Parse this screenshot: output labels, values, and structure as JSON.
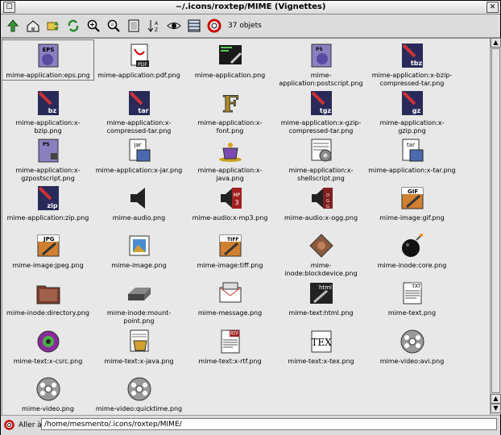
{
  "window": {
    "title": "~/.icons/roxtep/MIME (Vignettes)"
  },
  "toolbar": {
    "count_label": "37 objets"
  },
  "bottom": {
    "label": "Aller à :",
    "path": "/home/mesmento/.icons/roxtep/MIME/"
  },
  "items": [
    {
      "label": "mime-application:eps.png",
      "icon": "eps-icon"
    },
    {
      "label": "mime-application:pdf.png",
      "icon": "pdf-icon"
    },
    {
      "label": "mime-application.png",
      "icon": "application-icon"
    },
    {
      "label": "mime-application:postscript.png",
      "icon": "postscript-icon"
    },
    {
      "label": "mime-application:x-bzip-compressed-tar.png",
      "icon": "tbz-icon"
    },
    {
      "label": "mime-application:x-bzip.png",
      "icon": "bz-icon"
    },
    {
      "label": "mime-application:x-compressed-tar.png",
      "icon": "tar-icon"
    },
    {
      "label": "mime-application:x-font.png",
      "icon": "font-icon"
    },
    {
      "label": "mime-application:x-gzip-compressed-tar.png",
      "icon": "tgz-icon"
    },
    {
      "label": "mime-application:x-gzip.png",
      "icon": "gz-icon"
    },
    {
      "label": "mime-application:x-gzpostscript.png",
      "icon": "gzps-icon"
    },
    {
      "label": "mime-application:x-jar.png",
      "icon": "jar-icon"
    },
    {
      "label": "mime-application:x-java.png",
      "icon": "java-cup-icon"
    },
    {
      "label": "mime-application:x-shellscript.png",
      "icon": "shellscript-icon"
    },
    {
      "label": "mime-application:x-tar.png",
      "icon": "tar-box-icon"
    },
    {
      "label": "mime-application:zip.png",
      "icon": "zip-icon"
    },
    {
      "label": "mime-audio.png",
      "icon": "speaker-icon"
    },
    {
      "label": "mime-audio:x-mp3.png",
      "icon": "mp3-icon"
    },
    {
      "label": "mime-audio:x-ogg.png",
      "icon": "ogg-icon"
    },
    {
      "label": "mime-image:gif.png",
      "icon": "gif-icon"
    },
    {
      "label": "mime-image:jpeg.png",
      "icon": "jpeg-icon"
    },
    {
      "label": "mime-image.png",
      "icon": "image-icon"
    },
    {
      "label": "mime-image:tiff.png",
      "icon": "tiff-icon"
    },
    {
      "label": "mime-inode:blockdevice.png",
      "icon": "blockdevice-icon"
    },
    {
      "label": "mime-inode:core.png",
      "icon": "bomb-icon"
    },
    {
      "label": "mime-inode:directory.png",
      "icon": "folder-icon"
    },
    {
      "label": "mime-inode:mount-point.png",
      "icon": "drive-icon"
    },
    {
      "label": "mime-message.png",
      "icon": "message-icon"
    },
    {
      "label": "mime-text:html.png",
      "icon": "html-icon"
    },
    {
      "label": "mime-text.png",
      "icon": "text-icon"
    },
    {
      "label": "mime-text:x-csrc.png",
      "icon": "csrc-icon"
    },
    {
      "label": "mime-text:x-java.png",
      "icon": "java-text-icon"
    },
    {
      "label": "mime-text:x-rtf.png",
      "icon": "rtf-icon"
    },
    {
      "label": "mime-text:x-tex.png",
      "icon": "tex-icon"
    },
    {
      "label": "mime-video:avi.png",
      "icon": "avi-reel-icon"
    },
    {
      "label": "mime-video.png",
      "icon": "video-reel-icon"
    },
    {
      "label": "mime-video:quicktime.png",
      "icon": "mov-reel-icon"
    }
  ]
}
